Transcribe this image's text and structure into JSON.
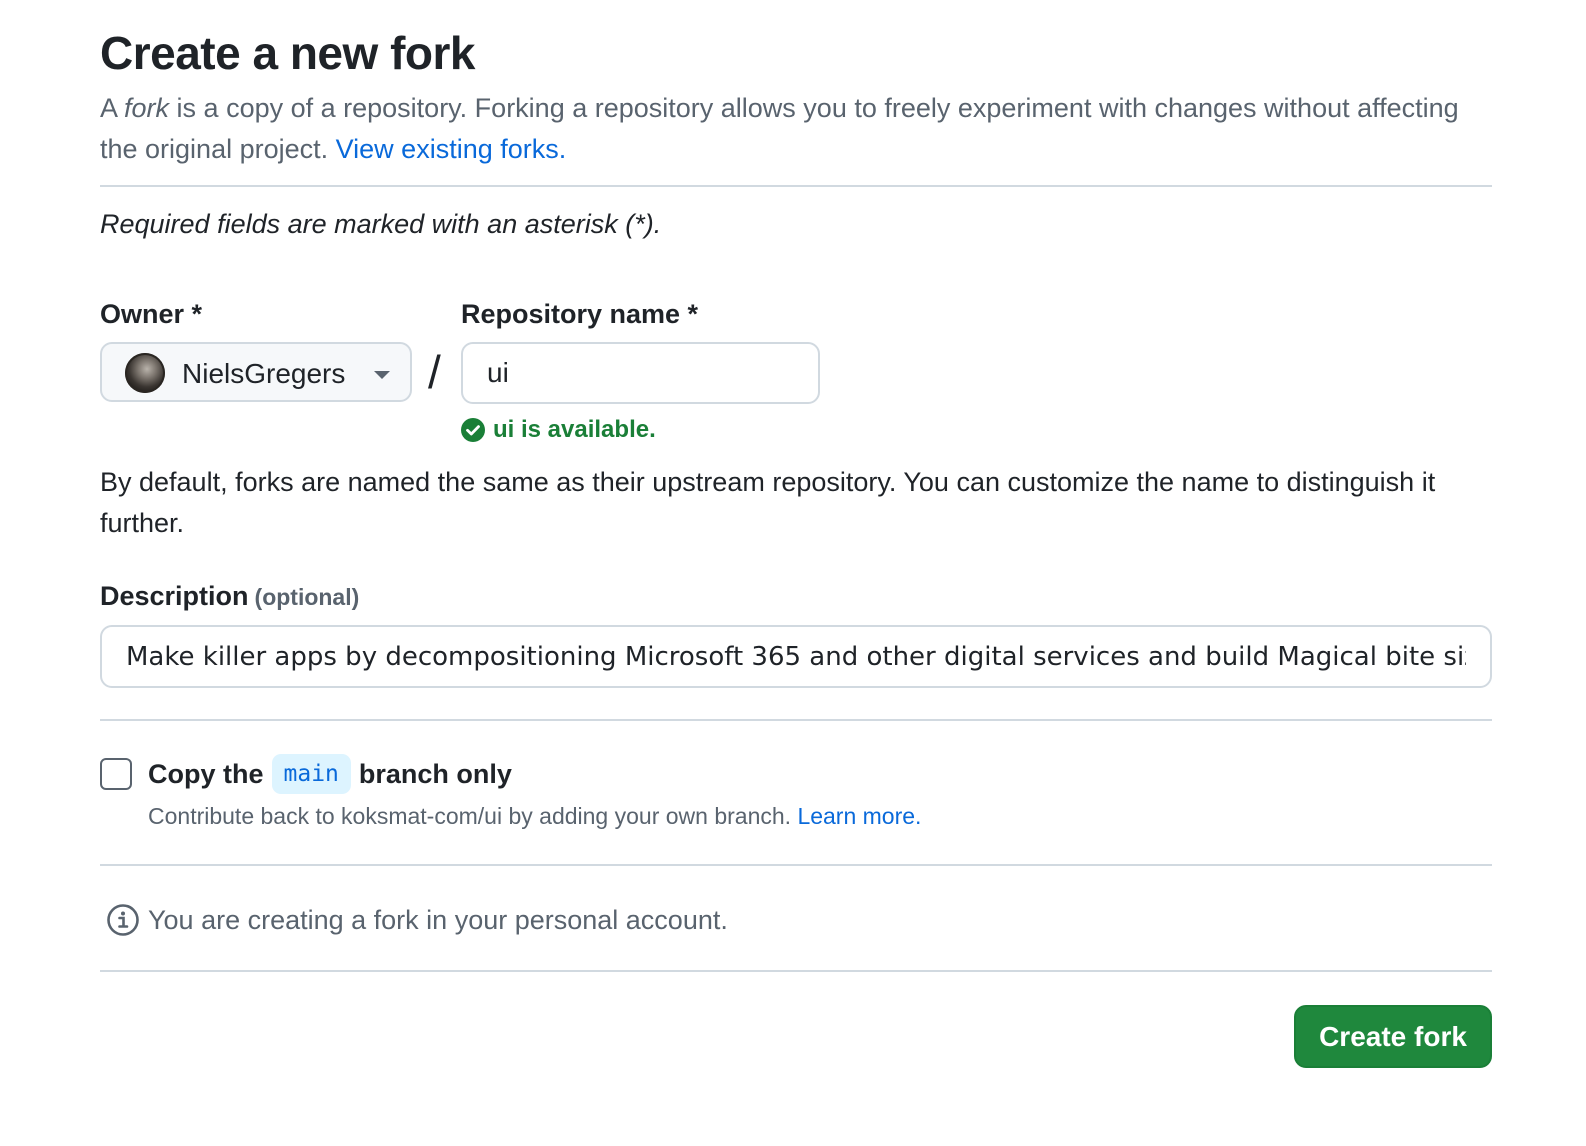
{
  "header": {
    "title": "Create a new fork",
    "intro_prefix": "A ",
    "intro_fork_word": "fork",
    "intro_text": " is a copy of a repository. Forking a repository allows you to freely experiment with changes without affecting the original project. ",
    "view_forks_link": "View existing forks."
  },
  "form": {
    "required_note": "Required fields are marked with an asterisk (*).",
    "owner": {
      "label": "Owner *",
      "selected": "NielsGregers",
      "avatar_icon": "user-avatar"
    },
    "separator": "/",
    "repository": {
      "label": "Repository name *",
      "value": "ui",
      "availability": "ui is available.",
      "availability_color": "#1a7f37"
    },
    "naming_help": "By default, forks are named the same as their upstream repository. You can customize the name to distinguish it further.",
    "description": {
      "label": "Description",
      "optional": "(optional)",
      "value": "Make killer apps by decompositioning Microsoft 365 and other digital services and build Magical bite size"
    },
    "copy_branch": {
      "checked": false,
      "label_prefix": "Copy the",
      "branch": "main",
      "label_suffix": "branch only",
      "hint": "Contribute back to koksmat-com/ui by adding your own branch. ",
      "learn_more": "Learn more."
    },
    "info_message": "You are creating a fork in your personal account.",
    "submit_label": "Create fork"
  },
  "colors": {
    "accent_link": "#0969da",
    "primary_button": "#1f883d",
    "muted_text": "#59636e",
    "border": "#d1d9e0"
  }
}
